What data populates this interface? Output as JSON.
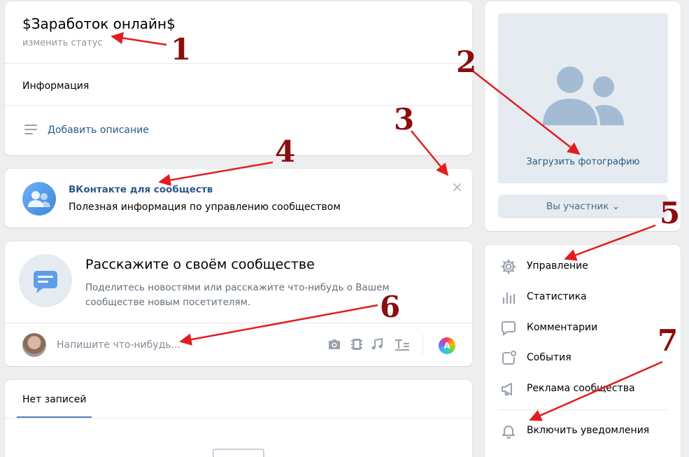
{
  "header": {
    "group_name": "$Заработок онлайн$",
    "status_link": "изменить статус",
    "info_label": "Информация",
    "add_description": "Добавить описание"
  },
  "promo": {
    "title": "ВКонтакте для сообществ",
    "subtitle": "Полезная информация по управлению сообществом",
    "close": "×"
  },
  "tell": {
    "heading": "Расскажите о своём сообществе",
    "text": "Поделитесь новостями или расскажите что-нибудь о Вашем сообществе новым посетителям.",
    "input_placeholder": "Напишите что-нибудь...",
    "ai_button": "A"
  },
  "posts": {
    "tab_label": "Нет записей"
  },
  "photo": {
    "upload_label": "Загрузить фотографию",
    "member_button": "Вы участник ⌄"
  },
  "menu": {
    "items": [
      {
        "label": "Управление",
        "icon": "gear-icon"
      },
      {
        "label": "Статистика",
        "icon": "stats-icon"
      },
      {
        "label": "Комментарии",
        "icon": "comment-icon"
      },
      {
        "label": "События",
        "icon": "events-icon"
      },
      {
        "label": "Реклама сообщества",
        "icon": "megaphone-icon"
      },
      {
        "label": "Включить уведомления",
        "icon": "bell-icon"
      }
    ]
  },
  "annotations": [
    "1",
    "2",
    "3",
    "4",
    "5",
    "6",
    "7"
  ],
  "colors": {
    "background": "#edeef0",
    "link": "#2a5885",
    "annotation": "#8b0d0d",
    "arrow": "#e11d1d"
  }
}
